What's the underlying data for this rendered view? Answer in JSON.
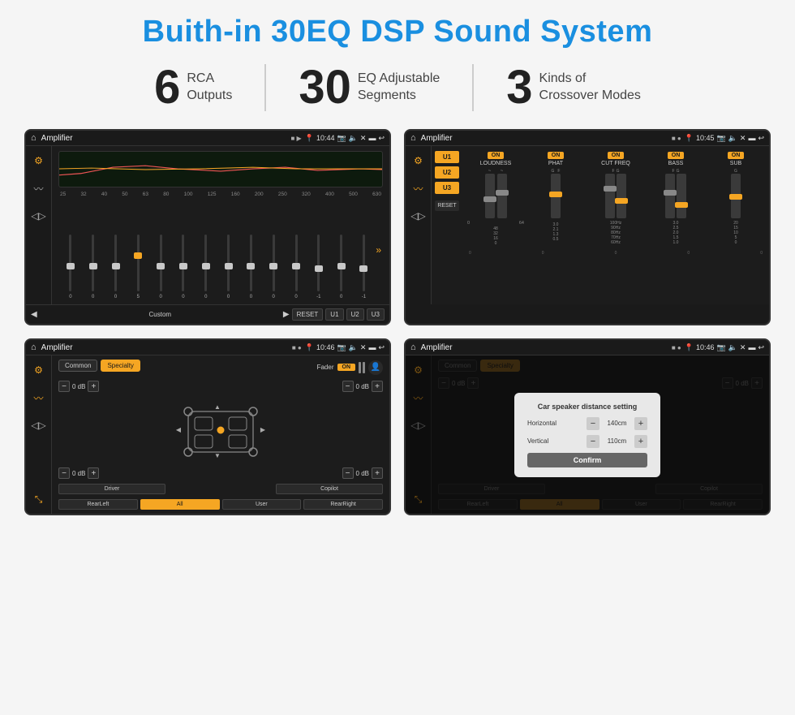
{
  "page": {
    "title": "Buith-in 30EQ DSP Sound System"
  },
  "stats": [
    {
      "number": "6",
      "line1": "RCA",
      "line2": "Outputs"
    },
    {
      "number": "30",
      "line1": "EQ Adjustable",
      "line2": "Segments"
    },
    {
      "number": "3",
      "line1": "Kinds of",
      "line2": "Crossover Modes"
    }
  ],
  "screens": {
    "eq": {
      "statusBar": {
        "appName": "Amplifier",
        "time": "10:44"
      },
      "freqLabels": [
        "25",
        "32",
        "40",
        "50",
        "63",
        "80",
        "100",
        "125",
        "160",
        "200",
        "250",
        "320",
        "400",
        "500",
        "630"
      ],
      "sliderValues": [
        "0",
        "0",
        "0",
        "5",
        "0",
        "0",
        "0",
        "0",
        "0",
        "0",
        "0",
        "-1",
        "0",
        "-1"
      ],
      "buttons": [
        "◀",
        "Custom",
        "▶",
        "RESET",
        "U1",
        "U2",
        "U3"
      ]
    },
    "crossover": {
      "statusBar": {
        "appName": "Amplifier",
        "time": "10:45"
      },
      "presets": [
        "U1",
        "U2",
        "U3"
      ],
      "modules": [
        {
          "label": "LOUDNESS",
          "on": true
        },
        {
          "label": "PHAT",
          "on": true
        },
        {
          "label": "CUT FREQ",
          "on": true
        },
        {
          "label": "BASS",
          "on": true
        },
        {
          "label": "SUB",
          "on": true
        }
      ],
      "resetLabel": "RESET"
    },
    "fader": {
      "statusBar": {
        "appName": "Amplifier",
        "time": "10:46"
      },
      "tabs": [
        "Common",
        "Specialty"
      ],
      "activeTab": "Specialty",
      "faderLabel": "Fader",
      "onToggle": "ON",
      "dbValues": [
        "0 dB",
        "0 dB",
        "0 dB",
        "0 dB"
      ],
      "footerButtons": [
        "Driver",
        "",
        "Copilot",
        "RearLeft",
        "All",
        "User",
        "RearRight"
      ]
    },
    "dialog": {
      "statusBar": {
        "appName": "Amplifier",
        "time": "10:46"
      },
      "tabs": [
        "Common",
        "Specialty"
      ],
      "dialogTitle": "Car speaker distance setting",
      "horizontal": {
        "label": "Horizontal",
        "value": "140cm"
      },
      "vertical": {
        "label": "Vertical",
        "value": "110cm"
      },
      "confirmLabel": "Confirm",
      "dbValues": [
        "0 dB",
        "0 dB"
      ],
      "footerButtons": [
        "Driver",
        "",
        "Copilot",
        "RearLeft",
        "All",
        "User",
        "RearRight"
      ]
    }
  }
}
